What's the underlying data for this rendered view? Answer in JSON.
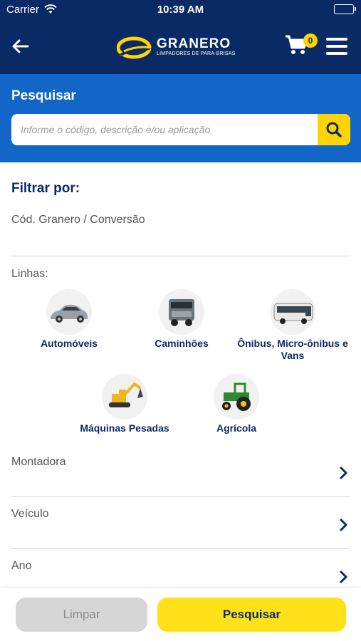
{
  "status_bar": {
    "carrier": "Carrier",
    "time": "10:39 AM"
  },
  "header": {
    "brand": "GRANERO",
    "tagline": "LIMPADORES DE PARA-BRISAS",
    "cart_count": "0",
    "icons": [
      "back-arrow-icon",
      "granero-logo",
      "cart-icon",
      "menu-icon"
    ]
  },
  "search": {
    "title": "Pesquisar",
    "placeholder": "Informe o código, descrição e/ou aplicação",
    "value": ""
  },
  "filters": {
    "title": "Filtrar por:",
    "code_placeholder": "Cód. Granero / Conversão",
    "linhas_label": "Linhas:",
    "categories": [
      {
        "label": "Automóveis",
        "icon": "car-icon"
      },
      {
        "label": "Caminhões",
        "icon": "truck-icon"
      },
      {
        "label": "Ônibus, Micro-ônibus e Vans",
        "icon": "bus-icon"
      },
      {
        "label": "Máquinas Pesadas",
        "icon": "excavator-icon"
      },
      {
        "label": "Agrícola",
        "icon": "tractor-icon"
      }
    ],
    "selects": [
      {
        "label": "Montadora"
      },
      {
        "label": "Veículo"
      },
      {
        "label": "Ano"
      }
    ]
  },
  "footer": {
    "clear_label": "Limpar",
    "search_label": "Pesquisar"
  },
  "colors": {
    "navy": "#0a2a66",
    "blue": "#1166c7",
    "yellow": "#ffd400"
  }
}
